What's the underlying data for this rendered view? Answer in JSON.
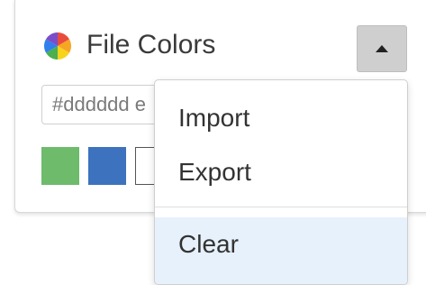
{
  "panel": {
    "title": "File Colors",
    "title_icon": "color-palette-icon",
    "collapse_icon": "caret-up-icon",
    "color_input": {
      "value": "",
      "placeholder": "#dddddd e"
    },
    "swatches": [
      {
        "color": "#6dbb6b"
      },
      {
        "color": "#3d72be"
      },
      {
        "color": "#ffffff"
      }
    ]
  },
  "menu": {
    "items": [
      {
        "label": "Import"
      },
      {
        "label": "Export"
      },
      {
        "label": "Clear",
        "highlighted": true
      }
    ]
  },
  "colors": {
    "palette": [
      "#e94c3d",
      "#f5a623",
      "#f8d31c",
      "#4caf50",
      "#2f80ed",
      "#7b4ec8"
    ],
    "menu_highlight": "#e7f1fb"
  }
}
